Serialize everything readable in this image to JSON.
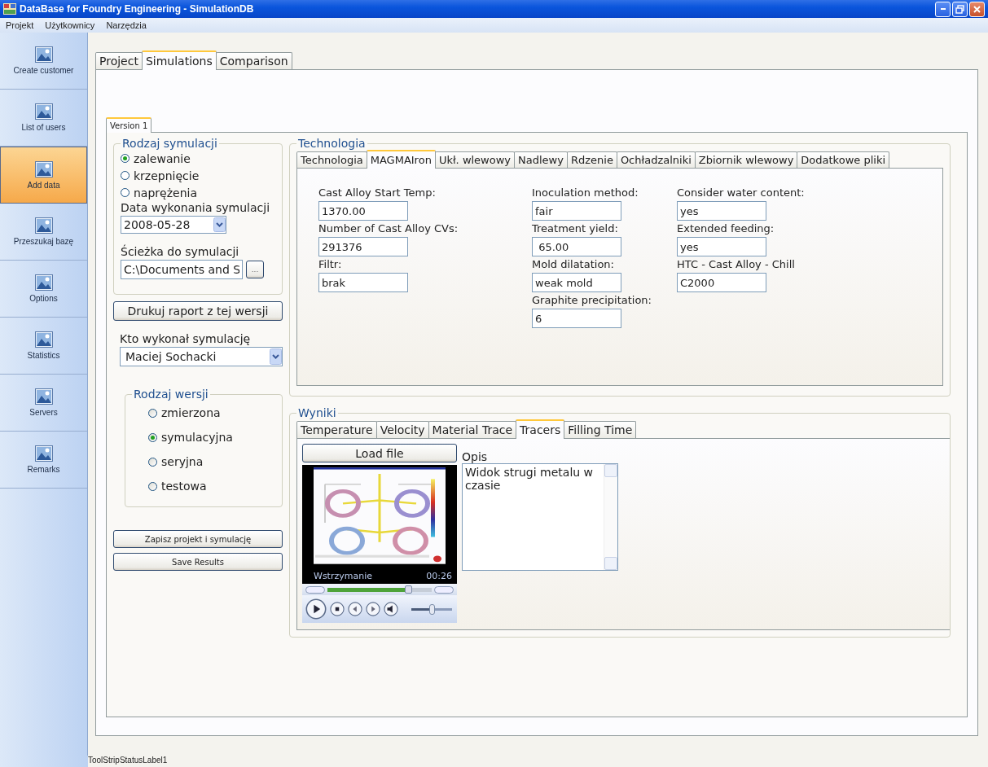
{
  "window": {
    "title": "DataBase for Foundry Engineering - SimulationDB"
  },
  "menu": [
    "Projekt",
    "Użytkownicy",
    "Narzędzia"
  ],
  "sidebar": [
    {
      "label": "Create customer",
      "selected": false
    },
    {
      "label": "List of users",
      "selected": false
    },
    {
      "label": "Add data",
      "selected": true
    },
    {
      "label": "Przeszukaj bazę",
      "selected": false
    },
    {
      "label": "Options",
      "selected": false
    },
    {
      "label": "Statistics",
      "selected": false
    },
    {
      "label": "Servers",
      "selected": false
    },
    {
      "label": "Remarks",
      "selected": false
    }
  ],
  "tabs": [
    {
      "label": "Project",
      "selected": false
    },
    {
      "label": "Simulations",
      "selected": true
    },
    {
      "label": "Comparison",
      "selected": false
    }
  ],
  "version_tabs": [
    {
      "label": "Version 1",
      "selected": true
    }
  ],
  "simulation_type": {
    "title": "Rodzaj symulacji",
    "options": [
      {
        "label": "zalewanie",
        "selected": true
      },
      {
        "label": "krzepnięcie",
        "selected": false
      },
      {
        "label": "naprężenia",
        "selected": false
      }
    ]
  },
  "date": {
    "label": "Data wykonania symulacji",
    "value": "2008-05-28"
  },
  "path": {
    "label": "Ścieżka do symulacji",
    "value": "C:\\Documents and S",
    "browse": "..."
  },
  "print_button": "Drukuj raport z tej wersji",
  "author": {
    "label": "Kto wykonał symulację",
    "value": "Maciej Sochacki"
  },
  "version_type": {
    "title": "Rodzaj wersji",
    "options": [
      {
        "label": "zmierzona",
        "selected": false
      },
      {
        "label": "symulacyjna",
        "selected": true
      },
      {
        "label": "seryjna",
        "selected": false
      },
      {
        "label": "testowa",
        "selected": false
      }
    ]
  },
  "buttons": [
    "Zapisz projekt i symulację",
    "Save Results"
  ],
  "technology": {
    "title": "Technologia",
    "tabs": [
      {
        "label": "Technologia",
        "selected": false
      },
      {
        "label": "MAGMAIron",
        "selected": true
      },
      {
        "label": "Ukł. wlewowy",
        "selected": false
      },
      {
        "label": "Nadlewy",
        "selected": false
      },
      {
        "label": "Rdzenie",
        "selected": false
      },
      {
        "label": "Ochładzalniki",
        "selected": false
      },
      {
        "label": "Zbiornik wlewowy",
        "selected": false
      },
      {
        "label": "Dodatkowe pliki",
        "selected": false
      }
    ],
    "columns": [
      [
        {
          "label": "Cast Alloy Start Temp:",
          "value": "1370.00"
        },
        {
          "label": "Number of Cast Alloy CVs:",
          "value": "291376"
        },
        {
          "label": "Filtr:",
          "value": "brak"
        }
      ],
      [
        {
          "label": "Inoculation method:",
          "value": "fair"
        },
        {
          "label": "Treatment yield:",
          "value": " 65.00"
        },
        {
          "label": "Mold dilatation:",
          "value": "weak mold"
        },
        {
          "label": "Graphite precipitation:",
          "value": "6"
        }
      ],
      [
        {
          "label": "Consider water content:",
          "value": "yes"
        },
        {
          "label": "Extended feeding:",
          "value": "yes"
        },
        {
          "label": "HTC - Cast Alloy - Chill",
          "value": "C2000"
        }
      ]
    ]
  },
  "results": {
    "title": "Wyniki",
    "tabs": [
      {
        "label": "Temperature",
        "selected": false
      },
      {
        "label": "Velocity",
        "selected": false
      },
      {
        "label": "Material Trace",
        "selected": false
      },
      {
        "label": "Tracers",
        "selected": true
      },
      {
        "label": "Filling Time",
        "selected": false
      }
    ],
    "load_button": "Load file",
    "player": {
      "status": "Wstrzymanie",
      "time": "00:26",
      "seek": {
        "level": 0.8
      },
      "volume": {
        "level": 0.5
      }
    },
    "description": {
      "label": "Opis",
      "value": "Widok strugi metalu w czasie"
    }
  },
  "status_bar": "ToolStripStatusLabel1"
}
